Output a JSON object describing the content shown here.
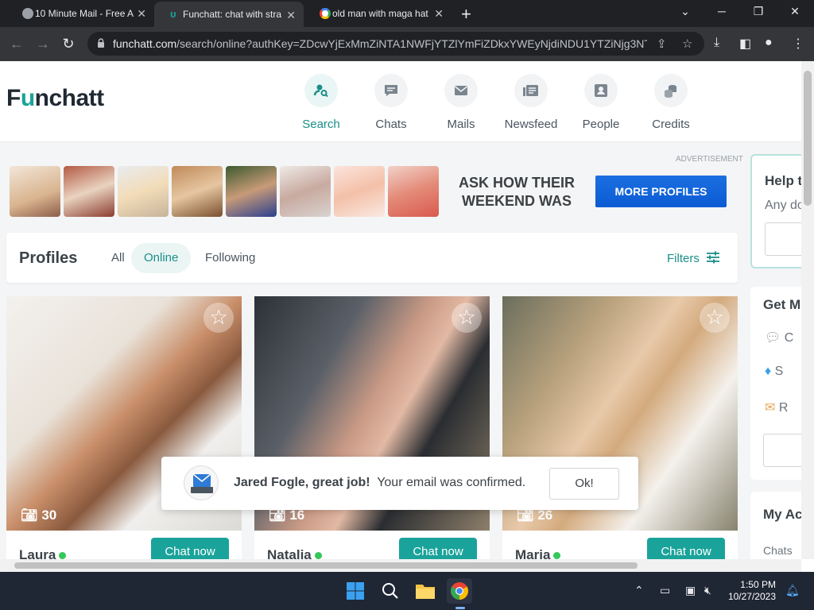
{
  "browser": {
    "tabs": [
      {
        "title": "10 Minute Mail - Free A",
        "active": false
      },
      {
        "title": "Funchatt: chat with stra",
        "active": true
      },
      {
        "title": "old man with maga hat",
        "active": false
      }
    ],
    "new_tab": "+",
    "url_host": "funchatt.com",
    "url_path": "/search/online?authKey=ZDcwYjExMmZiNTA1NWFjYTZlYmFiZDkxYWEyNjdiNDU1YTZiNjg3NT..."
  },
  "site": {
    "logo_pre": "F",
    "logo_u": "u",
    "logo_post": "nchatt",
    "nav": [
      {
        "label": "Search",
        "icon": "search-user-icon",
        "active": true
      },
      {
        "label": "Chats",
        "icon": "chat-bubble-icon",
        "active": false
      },
      {
        "label": "Mails",
        "icon": "envelope-icon",
        "active": false
      },
      {
        "label": "Newsfeed",
        "icon": "newsfeed-icon",
        "active": false
      },
      {
        "label": "People",
        "icon": "person-card-icon",
        "active": false
      },
      {
        "label": "Credits",
        "icon": "coins-icon",
        "active": false
      }
    ]
  },
  "ad": {
    "label": "ADVERTISEMENT",
    "headline": "ASK HOW THEIR WEEKEND WAS",
    "button": "MORE PROFILES"
  },
  "profiles": {
    "title": "Profiles",
    "tabs": [
      "All",
      "Online",
      "Following"
    ],
    "active_tab": "Online",
    "filters": "Filters",
    "cards": [
      {
        "name": "Laura",
        "photos": "30",
        "chat": "Chat now",
        "online": true
      },
      {
        "name": "Natalia",
        "photos": "16",
        "chat": "Chat now",
        "online": true
      },
      {
        "name": "Maria",
        "photos": "26",
        "chat": "Chat now",
        "online": true
      }
    ]
  },
  "sidebar": {
    "help_title": "Help t",
    "help_sub": "Any do",
    "get_title": "Get M",
    "get_items": [
      "C",
      "S",
      "R"
    ],
    "account_title": "My Ac",
    "account_item": "Chats"
  },
  "toast": {
    "name": "Jared Fogle, great job!",
    "message": "Your email was confirmed.",
    "ok": "Ok!"
  },
  "taskbar": {
    "time": "1:50 PM",
    "date": "10/27/2023"
  }
}
